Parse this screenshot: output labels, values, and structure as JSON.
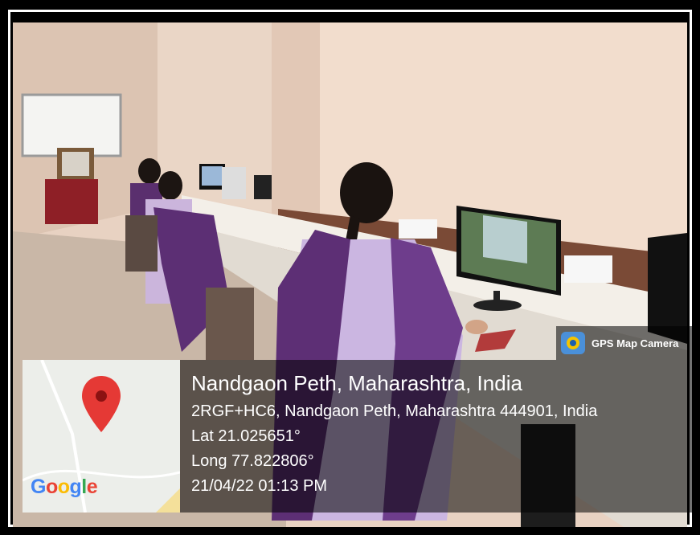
{
  "badge": {
    "app_name": "GPS Map Camera",
    "icon": "map-pin-camera-icon"
  },
  "location": {
    "title": "Nandgaon Peth, Maharashtra, India",
    "address": "2RGF+HC6, Nandgaon Peth, Maharashtra 444901, India",
    "latitude": "Lat 21.025651°",
    "longitude": "Long 77.822806°",
    "datetime": "21/04/22 01:13 PM"
  },
  "map": {
    "logo": [
      "G",
      "o",
      "o",
      "g",
      "l",
      "e"
    ],
    "marker_color": "#e53935",
    "marker_icon": "location-marker-icon"
  },
  "colors": {
    "wall": "#efd9c8",
    "uniform_lavender": "#c9b3e0",
    "dupatta_purple": "#6b3d8a",
    "desk": "#f1ede6"
  }
}
